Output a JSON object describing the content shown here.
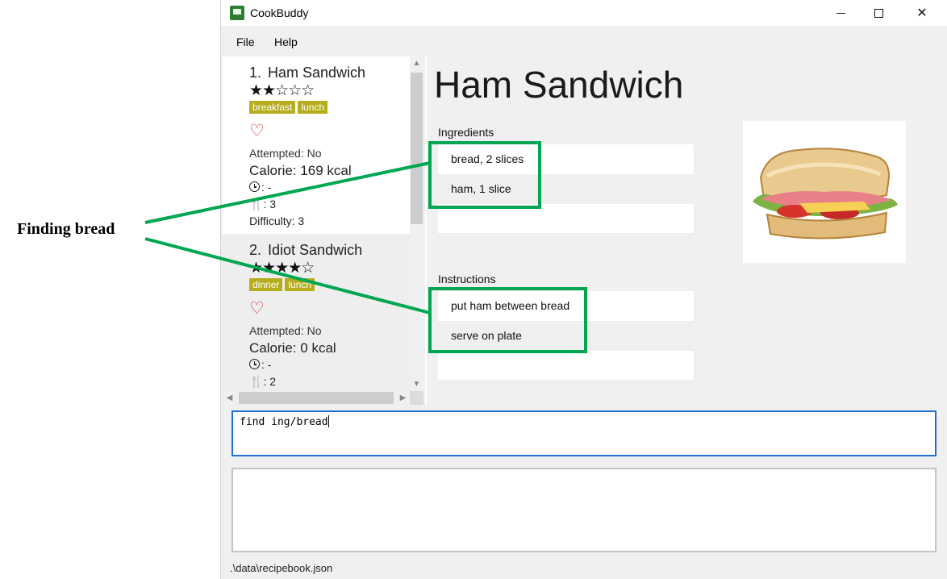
{
  "annotation": {
    "label": "Finding bread",
    "highlight_color": "#00a651"
  },
  "window": {
    "title": "CookBuddy",
    "controls": {
      "minimize": "minimize",
      "maximize": "maximize",
      "close": "✕"
    }
  },
  "menu": {
    "file": "File",
    "help": "Help"
  },
  "recipes": [
    {
      "index": "1.",
      "name": "Ham Sandwich",
      "stars": "★★☆☆☆",
      "rating": 2,
      "tags": [
        "breakfast",
        "lunch"
      ],
      "favourite_icon": "heart-outline-icon",
      "attempted": "Attempted: No",
      "calorie": "Calorie: 169 kcal",
      "time": ": -",
      "serving": ": 3",
      "difficulty": "Difficulty: 3"
    },
    {
      "index": "2.",
      "name": "Idiot Sandwich",
      "stars": "★★★★☆",
      "rating": 4,
      "tags": [
        "dinner",
        "lunch"
      ],
      "favourite_icon": "heart-outline-icon",
      "attempted": "Attempted: No",
      "calorie": "Calorie: 0 kcal",
      "time": ": -",
      "serving": ": 2"
    }
  ],
  "detail": {
    "title": "Ham Sandwich",
    "ingredients_label": "Ingredients",
    "ingredients": [
      "bread, 2 slices",
      "ham, 1 slice"
    ],
    "instructions_label": "Instructions",
    "instructions": [
      "put ham between bread",
      "serve on plate"
    ],
    "image_icon": "sandwich-image"
  },
  "command": {
    "value": "find ing/bread"
  },
  "result": {
    "value": ""
  },
  "status": {
    "path": ".\\data\\recipebook.json"
  },
  "colors": {
    "tag": "#b5ad1d",
    "heart": "#d32f2f",
    "command_border": "#1e6fd0"
  }
}
